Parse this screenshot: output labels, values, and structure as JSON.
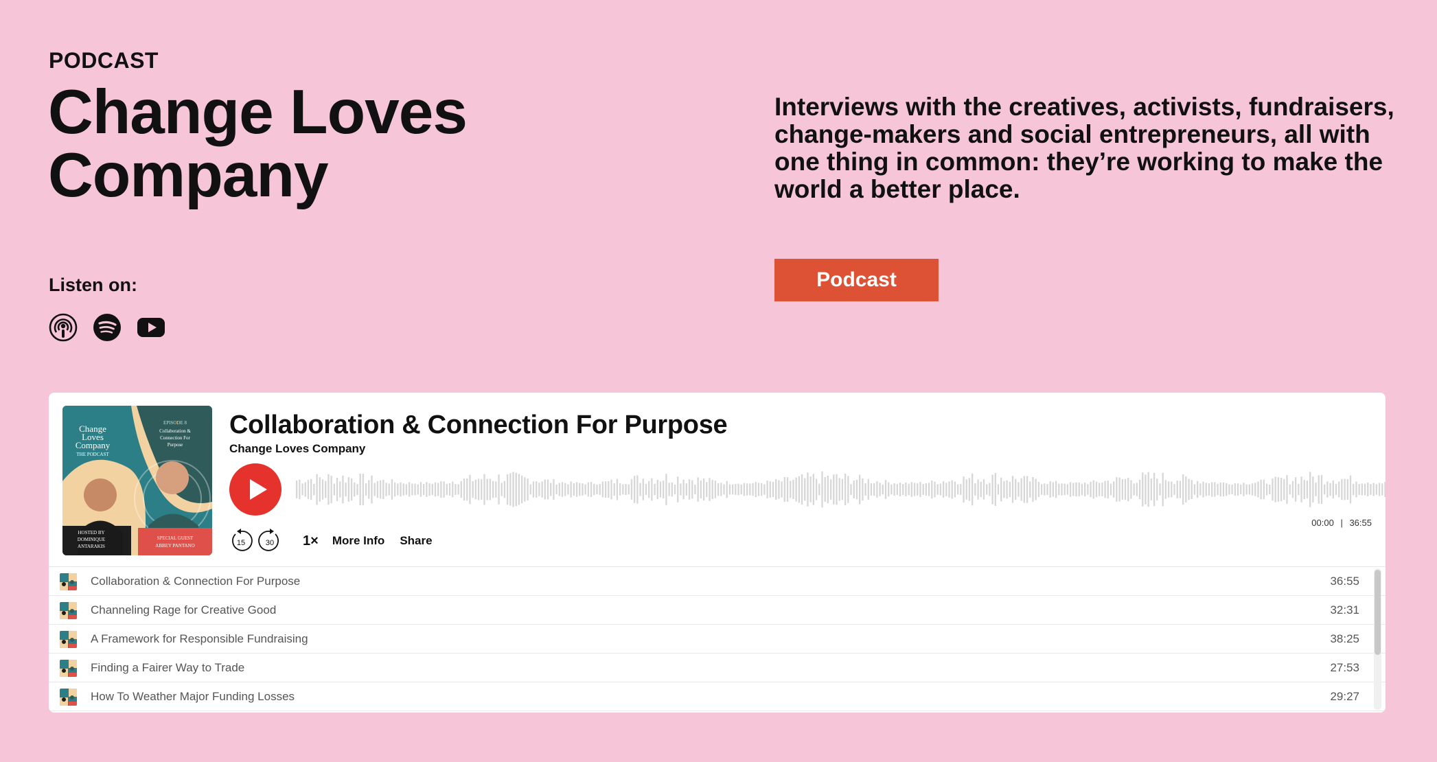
{
  "header": {
    "eyebrow": "PODCAST",
    "title_line1": "Change Loves",
    "title_line2": "Company",
    "description": "Interviews with the creatives, activists, fundraisers, change-makers and social entrepreneurs, all with one thing in common: they’re working to make the world a better place.",
    "cta_label": "Podcast"
  },
  "listen": {
    "label": "Listen on:",
    "platforms": [
      {
        "name": "Apple Podcasts",
        "icon": "podcast-icon"
      },
      {
        "name": "Spotify",
        "icon": "spotify-icon"
      },
      {
        "name": "YouTube",
        "icon": "youtube-icon"
      }
    ]
  },
  "player": {
    "episode_title": "Collaboration & Connection For Purpose",
    "show_name": "Change Loves Company",
    "artwork": {
      "show_line1": "Change",
      "show_line2": "Loves",
      "show_line3": "Company",
      "show_sub": "THE PODCAST",
      "episode_num": "EPISODE 8",
      "ep_line1": "Collaboration &",
      "ep_line2": "Connection For",
      "ep_line3": "Purpose",
      "host_line1": "HOSTED BY",
      "host_line2": "DOMINIQUE",
      "host_line3": "ANTARAKIS",
      "guest_line1": "SPECIAL GUEST",
      "guest_line2": "ABBEY PANTANO"
    },
    "current_time": "00:00",
    "separator": "|",
    "total_time": "36:55",
    "skip_back": "15",
    "skip_forward": "30",
    "speed": "1×",
    "more_info": "More Info",
    "share": "Share",
    "colors": {
      "play": "#e5322d",
      "cta": "#dd5234",
      "background": "#f6c5d8"
    }
  },
  "episodes": [
    {
      "title": "Collaboration & Connection For Purpose",
      "duration": "36:55"
    },
    {
      "title": "Channeling Rage for Creative Good",
      "duration": "32:31"
    },
    {
      "title": "A Framework for Responsible Fundraising",
      "duration": "38:25"
    },
    {
      "title": "Finding a Fairer Way to Trade",
      "duration": "27:53"
    },
    {
      "title": "How To Weather Major Funding Losses",
      "duration": "29:27"
    }
  ]
}
